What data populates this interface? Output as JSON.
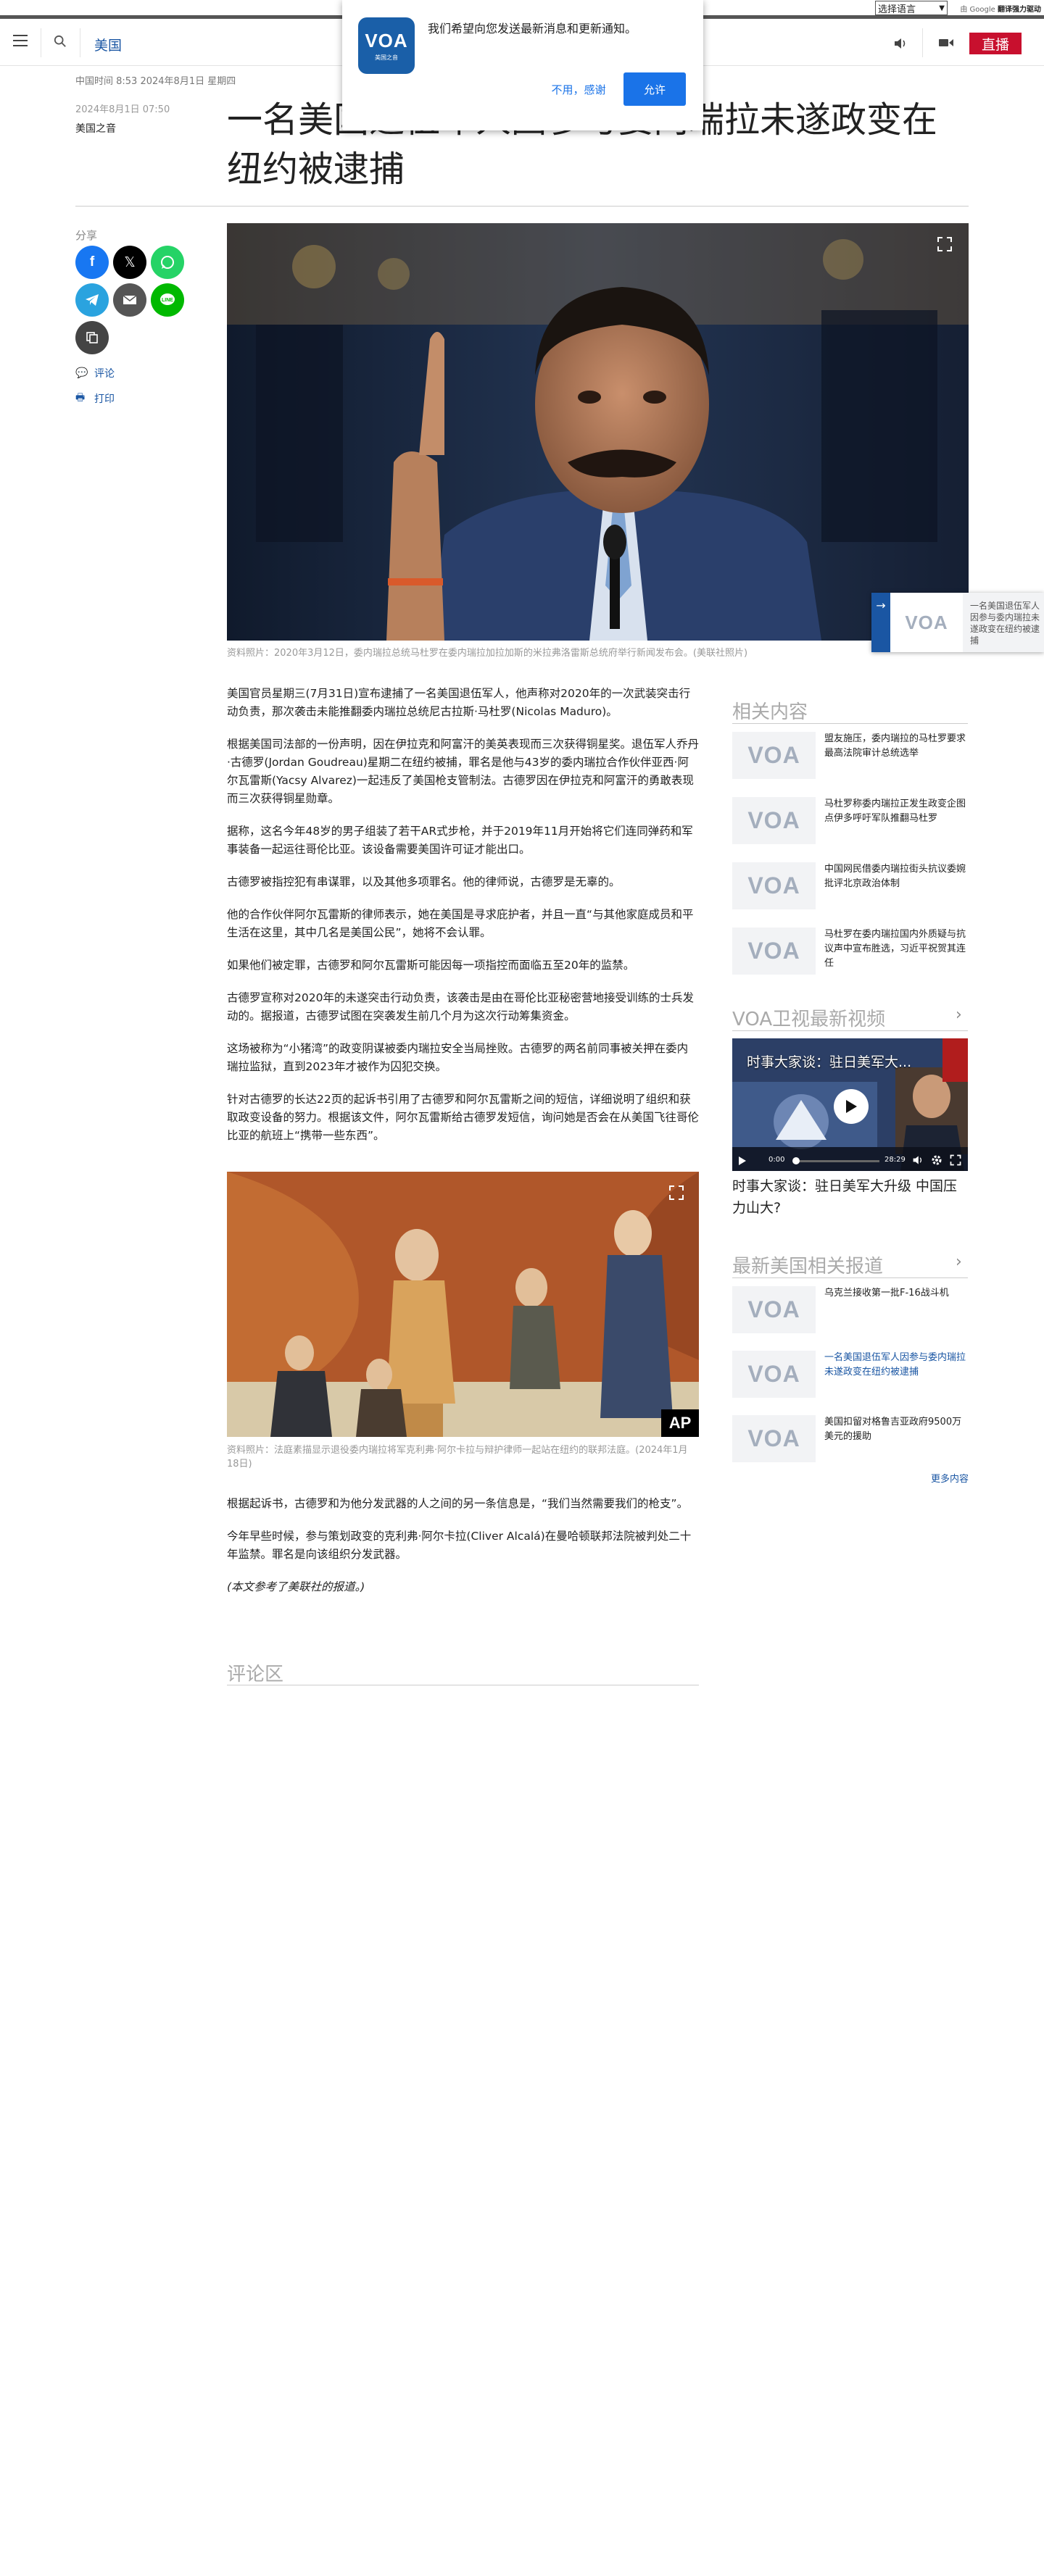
{
  "translate_bar": {
    "select_label": "选择语言",
    "powered_prefix": "由 Google",
    "powered_suffix": "翻译强力驱动"
  },
  "header": {
    "section": "美国",
    "live_label": "直播"
  },
  "notification": {
    "logo_text": "VOA",
    "logo_sub": "美国之音",
    "message": "我们希望向您发送最新消息和更新通知。",
    "deny_label": "不用，感谢",
    "allow_label": "允许"
  },
  "article": {
    "dateline": "中国时间 8:53 2024年8月1日 星期四",
    "pub_date": "2024年8月1日 07:50",
    "source": "美国之音",
    "title": "一名美国退伍军人因参与委内瑞拉未遂政变在纽约被逮捕",
    "hero_caption": "资料照片：2020年3月12日，委内瑞拉总统马杜罗在委内瑞拉加拉加斯的米拉弗洛雷斯总统府举行新闻发布会。(美联社照片)",
    "paragraphs": [
      "美国官员星期三(7月31日)宣布逮捕了一名美国退伍军人，他声称对2020年的一次武装突击行动负责，那次袭击未能推翻委内瑞拉总统尼古拉斯·马杜罗(Nicolas Maduro)。",
      "根据美国司法部的一份声明，因在伊拉克和阿富汗的美英表现而三次获得铜星奖。退伍军人乔丹·古德罗(Jordan Goudreau)星期二在纽约被捕，罪名是他与43岁的委内瑞拉合作伙伴亚西·阿尔瓦雷斯(Yacsy Alvarez)一起违反了美国枪支管制法。古德罗因在伊拉克和阿富汗的勇敢表现而三次获得铜星勋章。",
      "据称，这名今年48岁的男子组装了若干AR式步枪，并于2019年11月开始将它们连同弹药和军事装备一起运往哥伦比亚。该设备需要美国许可证才能出口。",
      "古德罗被指控犯有串谋罪，以及其他多项罪名。他的律师说，古德罗是无辜的。",
      "他的合作伙伴阿尔瓦雷斯的律师表示，她在美国是寻求庇护者，并且一直“与其他家庭成员和平生活在这里，其中几名是美国公民”，她将不会认罪。",
      "如果他们被定罪，古德罗和阿尔瓦雷斯可能因每一项指控而面临五至20年的监禁。",
      "古德罗宣称对2020年的未遂突击行动负责，该袭击是由在哥伦比亚秘密营地接受训练的士兵发动的。据报道，古德罗试图在突袭发生前几个月为这次行动筹集资金。",
      "这场被称为“小猪湾”的政变阴谋被委内瑞拉安全当局挫败。古德罗的两名前同事被关押在委内瑞拉监狱，直到2023年才被作为囚犯交换。",
      "针对古德罗的长达22页的起诉书引用了古德罗和阿尔瓦雷斯之间的短信，详细说明了组织和获取政变设备的努力。根据该文件，阿尔瓦雷斯给古德罗发短信，询问她是否会在从美国飞往哥伦比亚的航班上“携带一些东西”。"
    ],
    "court_caption": "资料照片：法庭素描显示退役委内瑞拉将军克利弗·阿尔卡拉与辩护律师一起站在纽约的联邦法庭。(2024年1月18日)",
    "ap_badge": "AP",
    "paragraphs2": [
      "根据起诉书，古德罗和为他分发武器的人之间的另一条信息是，“我们当然需要我们的枪支”。",
      "今年早些时候，参与策划政变的克利弗·阿尔卡拉(Cliver Alcalá)在曼哈顿联邦法院被判处二十年监禁。罪名是向该组织分发武器。"
    ],
    "note": "(本文参考了美联社的报道。)"
  },
  "share": {
    "label": "分享",
    "comment_label": "评论",
    "print_label": "打印"
  },
  "comments": {
    "heading": "评论区"
  },
  "sidebar": {
    "related": {
      "heading": "相关内容",
      "items": [
        {
          "text": "盟友施压，委内瑞拉的马杜罗要求最高法院审计总统选举"
        },
        {
          "text": "马杜罗称委内瑞拉正发生政变企图 点伊多呼吁军队推翻马杜罗"
        },
        {
          "text": "中国网民借委内瑞拉街头抗议委婉批评北京政治体制"
        },
        {
          "text": "马杜罗在委内瑞拉国内外质疑与抗议声中宣布胜选，习近平祝贺其连任"
        }
      ]
    },
    "video": {
      "heading": "VOA卫视最新视频",
      "overlay_title": "时事大家谈：驻日美军大...",
      "time_current": "0:00",
      "time_total": "28:29",
      "title": "时事大家谈：驻日美军大升级 中国压力山大?"
    },
    "latest": {
      "heading": "最新美国相关报道",
      "items": [
        {
          "text": "乌克兰接收第一批F-16战斗机"
        },
        {
          "text": "一名美国退伍军人因参与委内瑞拉未遂政变在纽约被逮捕"
        },
        {
          "text": "美国扣留对格鲁吉亚政府9500万美元的援助"
        }
      ],
      "more_label": "更多内容"
    }
  },
  "floating": {
    "text": "一名美国退伍军人因参与委内瑞拉未遂政变在纽约被逮捕"
  },
  "colors": {
    "brand_blue": "#1a56a3",
    "live_red": "#c8102e",
    "allow_blue": "#1a73e8"
  }
}
